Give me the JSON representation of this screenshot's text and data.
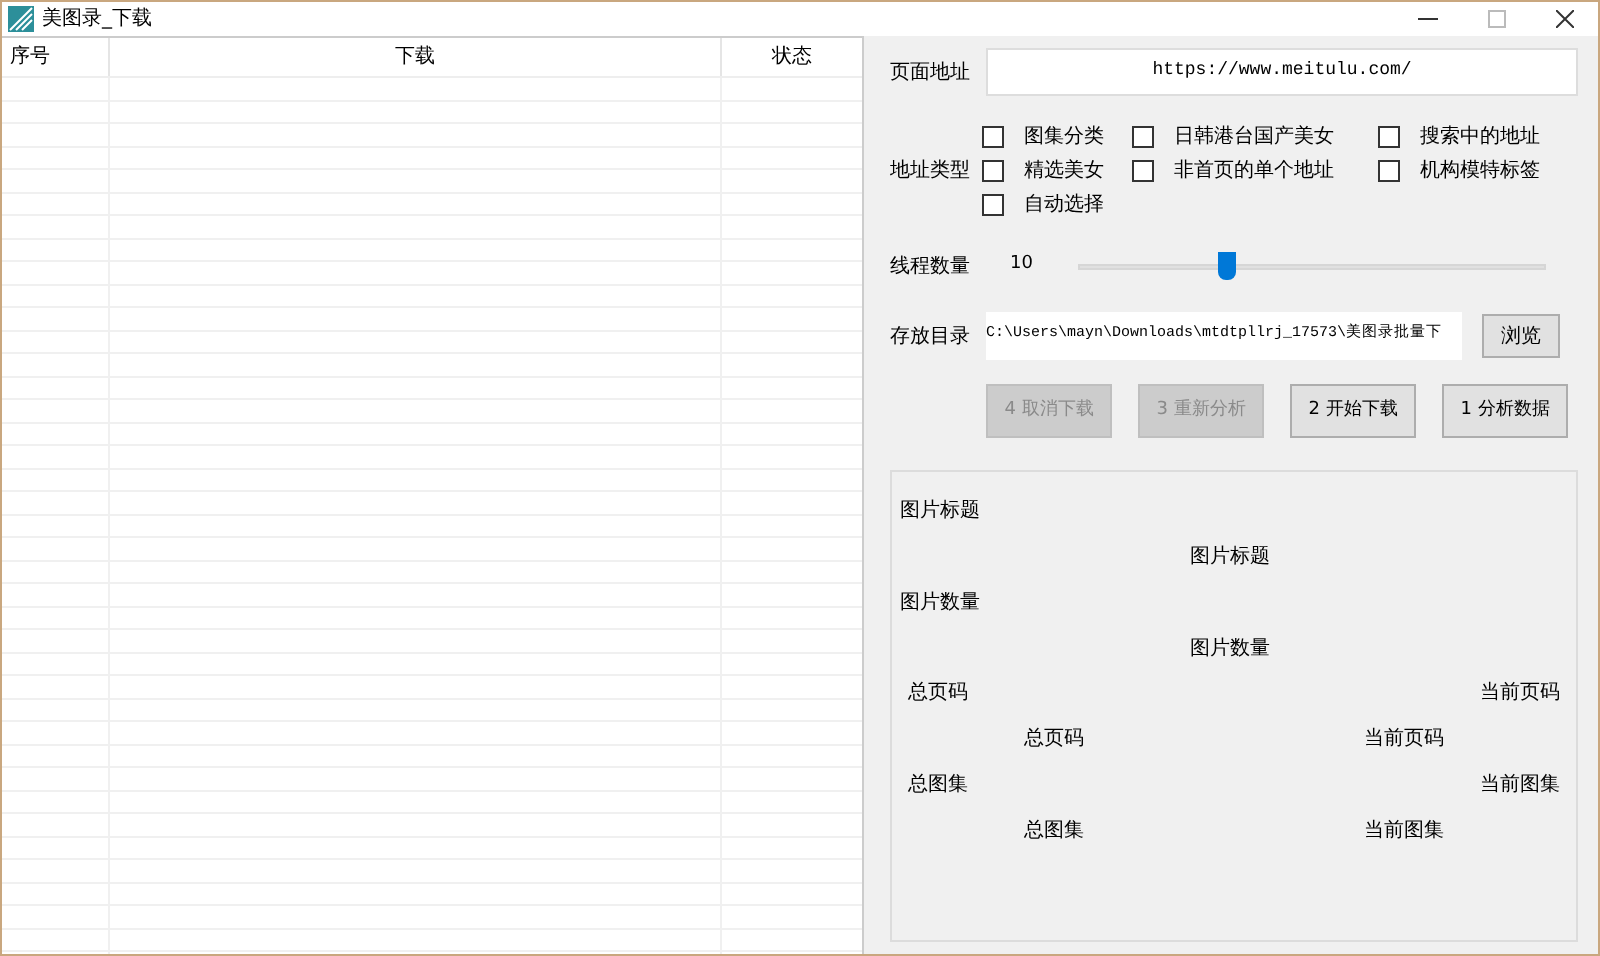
{
  "window": {
    "title": "美图录_下载"
  },
  "table": {
    "columns": [
      "序号",
      "下载",
      "状态"
    ]
  },
  "url": {
    "label": "页面地址",
    "value": "https://www.meitulu.com/"
  },
  "address_type": {
    "label": "地址类型",
    "options": [
      {
        "label": "图集分类",
        "checked": false
      },
      {
        "label": "日韩港台国产美女",
        "checked": false
      },
      {
        "label": "搜索中的地址",
        "checked": false
      },
      {
        "label": "精选美女",
        "checked": false
      },
      {
        "label": "非首页的单个地址",
        "checked": false
      },
      {
        "label": "机构模特标签",
        "checked": false
      },
      {
        "label": "自动选择",
        "checked": false
      }
    ]
  },
  "threads": {
    "label": "线程数量",
    "value": "10",
    "level": 0.31
  },
  "folder": {
    "label": "存放目录",
    "value": "C:\\Users\\mayn\\Downloads\\mtdtpllrj_17573\\美图录批量下",
    "browse": "浏览"
  },
  "actions": [
    {
      "label": "4 取消下载",
      "disabled": true
    },
    {
      "label": "3 重新分析",
      "disabled": true
    },
    {
      "label": "2 开始下载",
      "disabled": false
    },
    {
      "label": "1 分析数据",
      "disabled": false
    }
  ],
  "info": {
    "title_label": "图片标题",
    "title_value": "图片标题",
    "count_label": "图片数量",
    "count_value": "图片数量",
    "total_pages_label": "总页码",
    "current_page_label": "当前页码",
    "total_pages_value": "总页码",
    "current_page_value": "当前页码",
    "total_albums_label": "总图集",
    "current_album_label": "当前图集",
    "total_albums_value": "总图集",
    "current_album_value": "当前图集"
  }
}
